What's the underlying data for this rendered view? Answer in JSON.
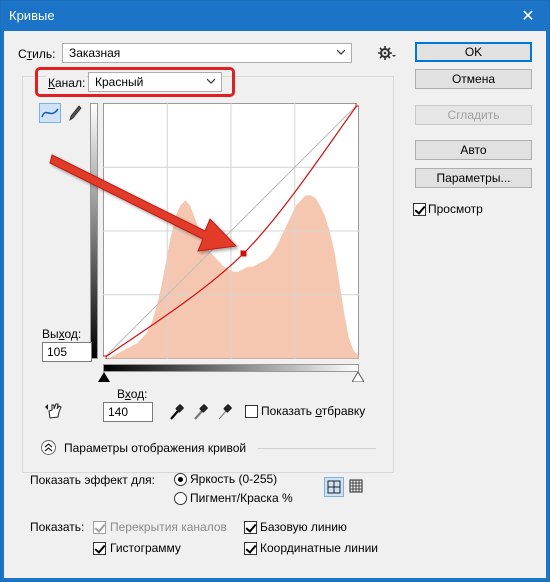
{
  "window": {
    "title": "Кривые",
    "close_glyph": "✕"
  },
  "style_row": {
    "label_pre": "С",
    "label_ul": "т",
    "label_post": "иль:",
    "value": "Заказная"
  },
  "channel_row": {
    "label_ul": "К",
    "label_post": "анал:",
    "value": "Красный",
    "highlight_color": "#e02020"
  },
  "buttons": {
    "ok": "OK",
    "cancel": "Отмена",
    "smooth": "Сгладить",
    "auto": "Авто",
    "options": "Параметры..."
  },
  "preview": {
    "label": "Просмотр",
    "checked": true
  },
  "output": {
    "label_pre": "Вы",
    "label_ul": "х",
    "label_post": "од:",
    "value": "105"
  },
  "input": {
    "label_pre": "В",
    "label_ul": "х",
    "label_post": "од:",
    "value": "140"
  },
  "clipping": {
    "label_pre": "Показать ",
    "label_ul": "о",
    "label_post": "тбравку",
    "checked": false
  },
  "curve_display": {
    "label": "Параметры отображения кривой"
  },
  "show_effect": {
    "label": "Показать эффект для:",
    "option1": "Яркость (0-255)",
    "option2": "Пигмент/Краска %",
    "selected": "option1"
  },
  "show": {
    "label": "Показать:",
    "overlays": {
      "label": "Перекрытия каналов",
      "checked": true,
      "disabled": true
    },
    "baseline": {
      "label": "Базовую линию",
      "checked": true
    },
    "histogram": {
      "label": "Гистограмму",
      "checked": true
    },
    "gridlines": {
      "label": "Координатные линии",
      "checked": true
    }
  },
  "chart_data": {
    "type": "area",
    "xlim": [
      0,
      255
    ],
    "ylim": [
      0,
      255
    ],
    "curve_points": [
      [
        0,
        0
      ],
      [
        140,
        105
      ],
      [
        255,
        255
      ]
    ],
    "selected_point": [
      140,
      105
    ],
    "histogram_color": "#f6c7b0",
    "curve_color": "#d01010",
    "histogram": [
      0,
      0,
      1,
      2,
      3,
      4,
      5,
      6,
      8,
      10,
      14,
      20,
      28,
      38,
      48,
      56,
      60,
      62,
      60,
      55,
      50,
      46,
      42,
      40,
      38,
      36,
      35,
      34,
      34,
      35,
      36,
      36,
      37,
      38,
      39,
      41,
      44,
      48,
      52,
      56,
      60,
      62,
      64,
      64,
      63,
      60,
      56,
      50,
      42,
      30,
      18,
      8,
      3,
      1
    ]
  },
  "icons": {
    "gear": "gear-icon",
    "curve_tool": "curve-tool-icon",
    "pencil_tool": "pencil-icon",
    "hand_tool": "hand-adjust-icon",
    "black_eyedropper": "eyedropper-black-icon",
    "gray_eyedropper": "eyedropper-gray-icon",
    "white_eyedropper": "eyedropper-white-icon",
    "collapse": "chevron-up-icon",
    "simple_grid": "simple-grid-icon",
    "detailed_grid": "detailed-grid-icon"
  }
}
